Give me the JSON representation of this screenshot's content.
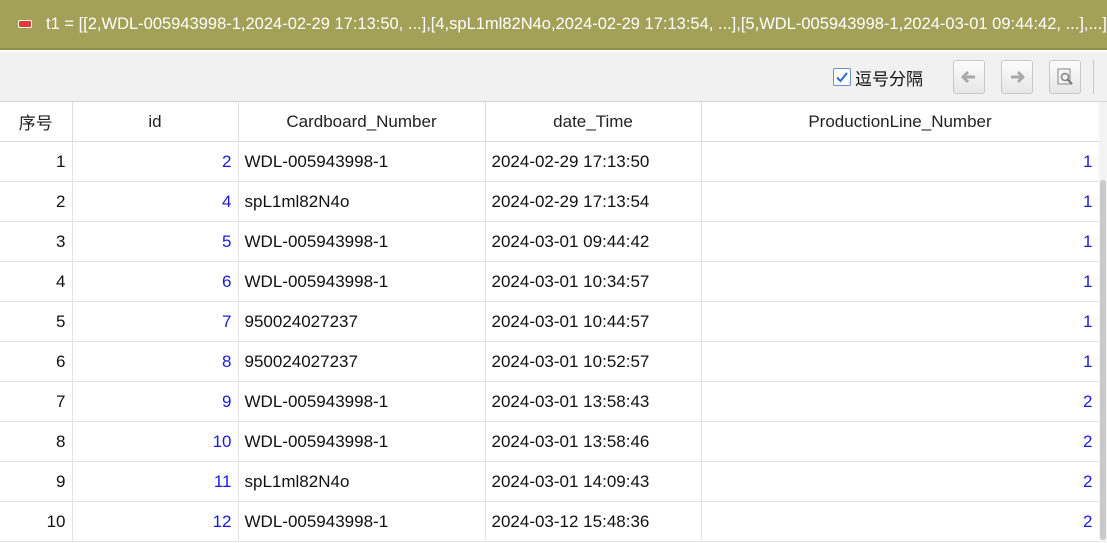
{
  "window": {
    "title": "t1 = [[2,WDL-005943998-1,2024-02-29 17:13:50, ...],[4,spL1ml82N4o,2024-02-29 17:13:54, ...],[5,WDL-005943998-1,2024-03-01 09:44:42, ...],...]"
  },
  "toolbar": {
    "comma_label": "逗号分隔",
    "comma_checked": true
  },
  "table": {
    "columns": [
      "序号",
      "id",
      "Cardboard_Number",
      "date_Time",
      "ProductionLine_Number"
    ],
    "rows": [
      {
        "seq": "1",
        "id": "2",
        "card": "WDL-005943998-1",
        "time": "2024-02-29 17:13:50",
        "line": "1"
      },
      {
        "seq": "2",
        "id": "4",
        "card": "spL1ml82N4o",
        "time": "2024-02-29 17:13:54",
        "line": "1"
      },
      {
        "seq": "3",
        "id": "5",
        "card": "WDL-005943998-1",
        "time": "2024-03-01 09:44:42",
        "line": "1"
      },
      {
        "seq": "4",
        "id": "6",
        "card": "WDL-005943998-1",
        "time": "2024-03-01 10:34:57",
        "line": "1"
      },
      {
        "seq": "5",
        "id": "7",
        "card": "950024027237",
        "time": "2024-03-01 10:44:57",
        "line": "1"
      },
      {
        "seq": "6",
        "id": "8",
        "card": "950024027237",
        "time": "2024-03-01 10:52:57",
        "line": "1"
      },
      {
        "seq": "7",
        "id": "9",
        "card": "WDL-005943998-1",
        "time": "2024-03-01 13:58:43",
        "line": "2"
      },
      {
        "seq": "8",
        "id": "10",
        "card": "WDL-005943998-1",
        "time": "2024-03-01 13:58:46",
        "line": "2"
      },
      {
        "seq": "9",
        "id": "11",
        "card": "spL1ml82N4o",
        "time": "2024-03-01 14:09:43",
        "line": "2"
      },
      {
        "seq": "10",
        "id": "12",
        "card": "WDL-005943998-1",
        "time": "2024-03-12 15:48:36",
        "line": "2"
      }
    ]
  },
  "icons": {
    "collapse": "collapse-icon",
    "back": "arrow-left-icon",
    "forward": "arrow-right-icon",
    "preview": "preview-icon"
  },
  "colors": {
    "titlebar": "#a3a158",
    "value_blue": "#1a1adc"
  }
}
